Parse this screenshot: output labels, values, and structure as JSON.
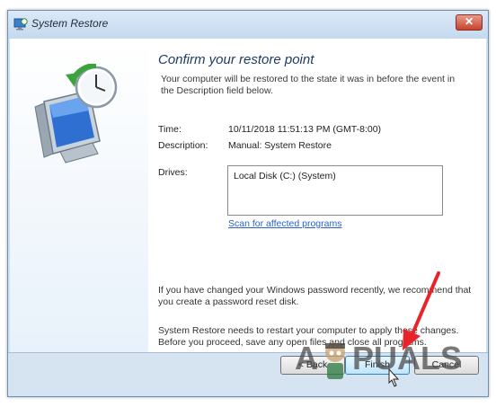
{
  "window": {
    "title": "System Restore",
    "close_glyph": "✕"
  },
  "icons": {
    "app": "system-restore-icon",
    "hero": "computer-restore-clock-icon",
    "close": "close-icon"
  },
  "content": {
    "heading": "Confirm your restore point",
    "intro": "Your computer will be restored to the state it was in before the event in the Description field below.",
    "time_label": "Time:",
    "time_value": "10/11/2018 11:51:13 PM (GMT-8:00)",
    "description_label": "Description:",
    "description_value": "Manual: System Restore",
    "drives_label": "Drives:",
    "drives": [
      "Local Disk (C:) (System)"
    ],
    "scan_link": "Scan for affected programs",
    "password_note": "If you have changed your Windows password recently, we recommend that you create a password reset disk.",
    "restart_note": "System Restore needs to restart your computer to apply these changes. Before you proceed, save any open files and close all programs."
  },
  "buttons": {
    "back": "< Back",
    "finish": "Finish",
    "cancel": "Cancel"
  },
  "watermark": {
    "brand_left": "A",
    "brand_right": "PUALS"
  },
  "colors": {
    "heading": "#1f3b66",
    "link": "#2a63c4",
    "arrow": "#e8232a",
    "footer": "#d6e4f2"
  }
}
